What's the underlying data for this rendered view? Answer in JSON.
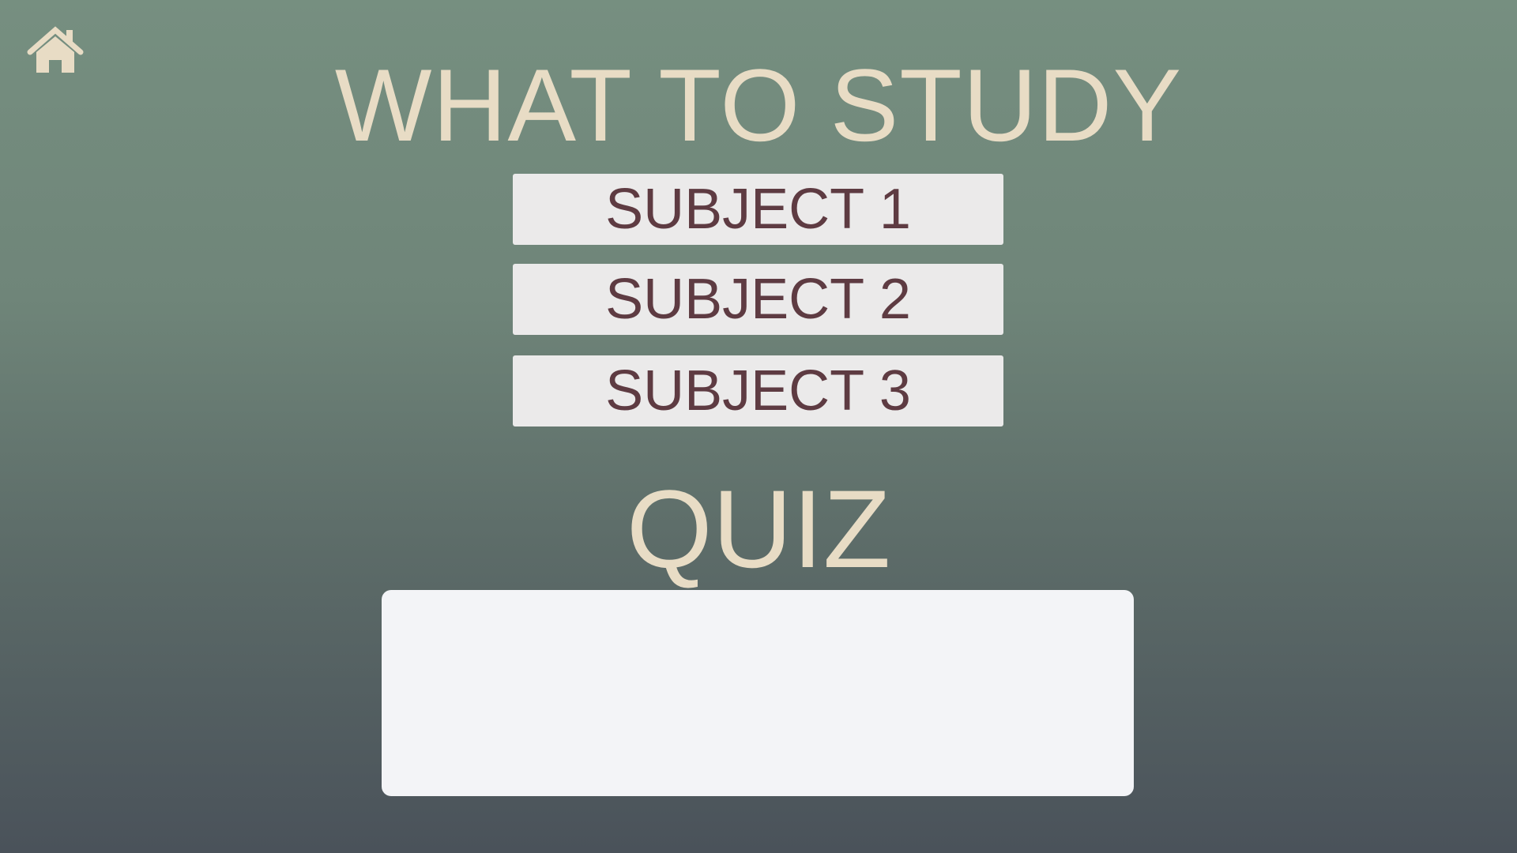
{
  "home": {
    "icon": "home-icon",
    "color": "#e8dcc5"
  },
  "header": {
    "title": "WHAT TO STUDY"
  },
  "subjects": [
    {
      "label": "SUBJECT 1"
    },
    {
      "label": "SUBJECT 2"
    },
    {
      "label": "SUBJECT 3"
    }
  ],
  "quiz": {
    "title": "QUIZ",
    "content": ""
  },
  "colors": {
    "title_text": "#e8dcc5",
    "button_bg": "#ebeaea",
    "button_text": "#5e3b42",
    "quiz_box_bg": "#f3f4f7"
  }
}
